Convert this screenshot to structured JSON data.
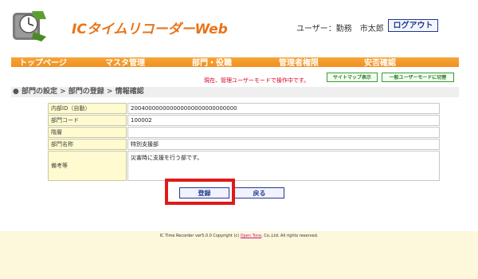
{
  "header": {
    "app_title": "ICタイムリコーダーWeb",
    "user_label": "ユーザー：勤務　市太郎",
    "logout_label": "ログアウト"
  },
  "nav": {
    "items": [
      "トップページ",
      "マスタ管理",
      "部門・役職",
      "管理者権限",
      "安否確認"
    ]
  },
  "mode": {
    "status_text": "現在、管理ユーザーモードで操作中です。",
    "sitemap_button": "サイトマップ表示",
    "general_mode_button": "一般ユーザーモードに切替"
  },
  "breadcrumb": "● 部門の設定 > 部門の登録 > 情報確認",
  "form": {
    "rows": [
      {
        "label": "内部ID（自動）",
        "value": "200400000000000000000000000000"
      },
      {
        "label": "部門コード",
        "value": "100002"
      },
      {
        "label": "階層",
        "value": ""
      },
      {
        "label": "部門名称",
        "value": "特別支援部"
      },
      {
        "label": "備考等",
        "value": "災害時に支援を行う部です。"
      }
    ]
  },
  "actions": {
    "register_label": "登録",
    "back_label": "戻る"
  },
  "footer": {
    "prefix": "IC Time Recorder ver5.0.0 Copyright (c) ",
    "link": "Open Tone",
    "suffix": ", Co.,Ltd. All rights reserved."
  },
  "colors": {
    "accent": "#e8741a",
    "nav_bg": "#f0901e",
    "highlight": "#e01a1a",
    "button_border": "#1f3a8f"
  }
}
